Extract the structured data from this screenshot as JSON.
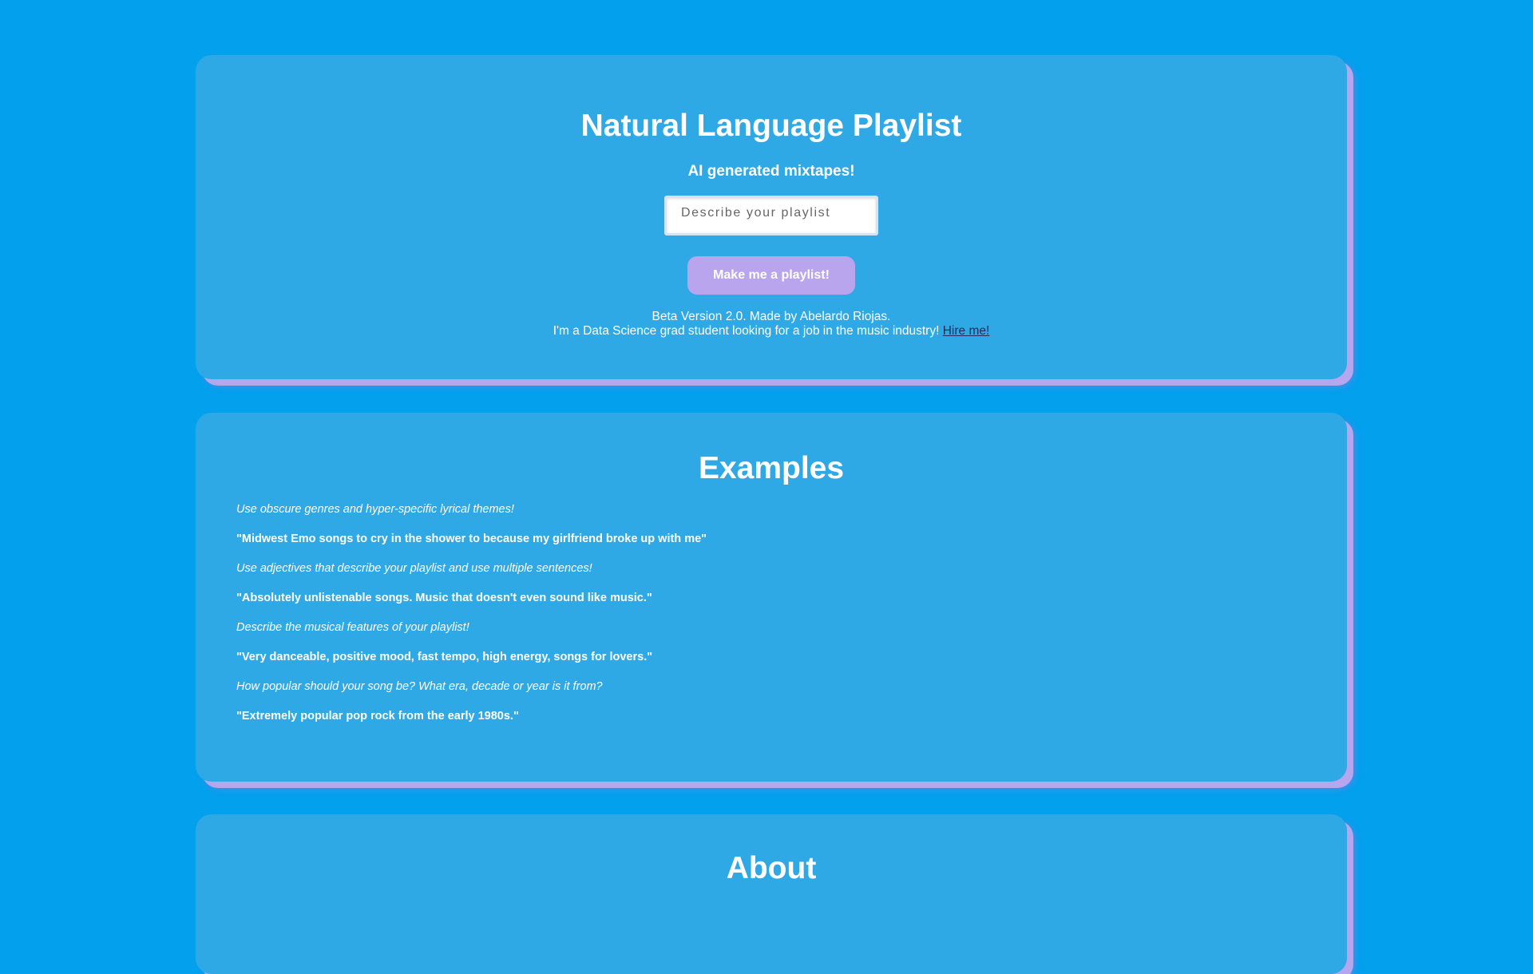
{
  "hero": {
    "title": "Natural Language Playlist",
    "subtitle": "AI generated mixtapes!",
    "input_placeholder": "Describe your playlist",
    "input_value": "",
    "button_label": "Make me a playlist!",
    "footer_line1": "Beta Version 2.0. Made by Abelardo Riojas.",
    "footer_line2": "I'm a Data Science grad student looking for a job in the music industry!",
    "hire_link": "Hire me!"
  },
  "examples": {
    "title": "Examples",
    "items": [
      {
        "text": "Use obscure genres and hyper-specific lyrical themes!"
      },
      {
        "text": "\"Midwest Emo songs to cry in the shower to because my girlfriend broke up with me\""
      },
      {
        "text": "Use adjectives that describe your playlist and use multiple sentences!"
      },
      {
        "text": "\"Absolutely unlistenable songs. Music that doesn't even sound like music.\""
      },
      {
        "text": "Describe the musical features of your playlist!"
      },
      {
        "text": "\"Very danceable, positive mood, fast tempo, high energy, songs for lovers.\""
      },
      {
        "text": "How popular should your song be? What era, decade or year is it from?"
      },
      {
        "text": "\"Extremely popular pop rock from the early 1980s.\""
      }
    ]
  },
  "about": {
    "title": "About"
  },
  "colors": {
    "background": "#03a0ee",
    "card": "#2ea9e6",
    "accent": "#b8a5ee",
    "link": "#2a2a5a"
  }
}
